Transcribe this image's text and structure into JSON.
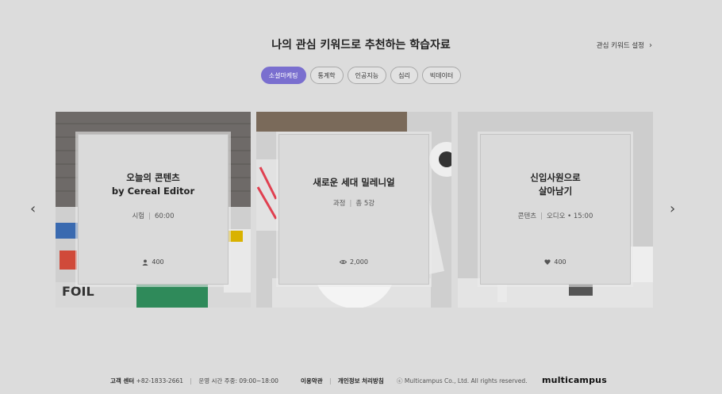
{
  "header": {
    "title": "나의 관심 키워드로 추천하는 학습자료",
    "settings_label": "관심 키워드 설정",
    "settings_chevron": "›"
  },
  "chips": [
    {
      "label": "소셜마케팅",
      "active": true
    },
    {
      "label": "통계학",
      "active": false
    },
    {
      "label": "인공지능",
      "active": false
    },
    {
      "label": "심리",
      "active": false
    },
    {
      "label": "빅데이터",
      "active": false
    }
  ],
  "cards": [
    {
      "title_line1": "오늘의 콘텐츠",
      "title_line2": "by Cereal Editor",
      "meta1": "시험",
      "meta2": "60:00",
      "stat_icon": "person-icon",
      "stat": "400"
    },
    {
      "title_line1": "새로운 세대 밀레니얼",
      "title_line2": "",
      "meta1": "과정",
      "meta2": "총 5강",
      "stat_icon": "eye-icon",
      "stat": "2,000"
    },
    {
      "title_line1": "신입사원으로",
      "title_line2": "살아남기",
      "meta1": "콘텐츠",
      "meta2": "오디오 • 15:00",
      "stat_icon": "heart-icon",
      "stat": "400"
    }
  ],
  "nav": {
    "prev": "‹",
    "next": "›"
  },
  "footer": {
    "cs_label": "고객 센터",
    "cs_phone": "+82-1833-2661",
    "hours": "운영 시간 주중: 09:00~18:00",
    "terms": "이용약관",
    "privacy": "개인정보 처리방침",
    "copyright": "ⓒ Multicampus Co., Ltd. All rights reserved.",
    "logo": "multicampus"
  },
  "colors": {
    "accent": "#7a6fcf",
    "background": "#dcdcdc"
  }
}
